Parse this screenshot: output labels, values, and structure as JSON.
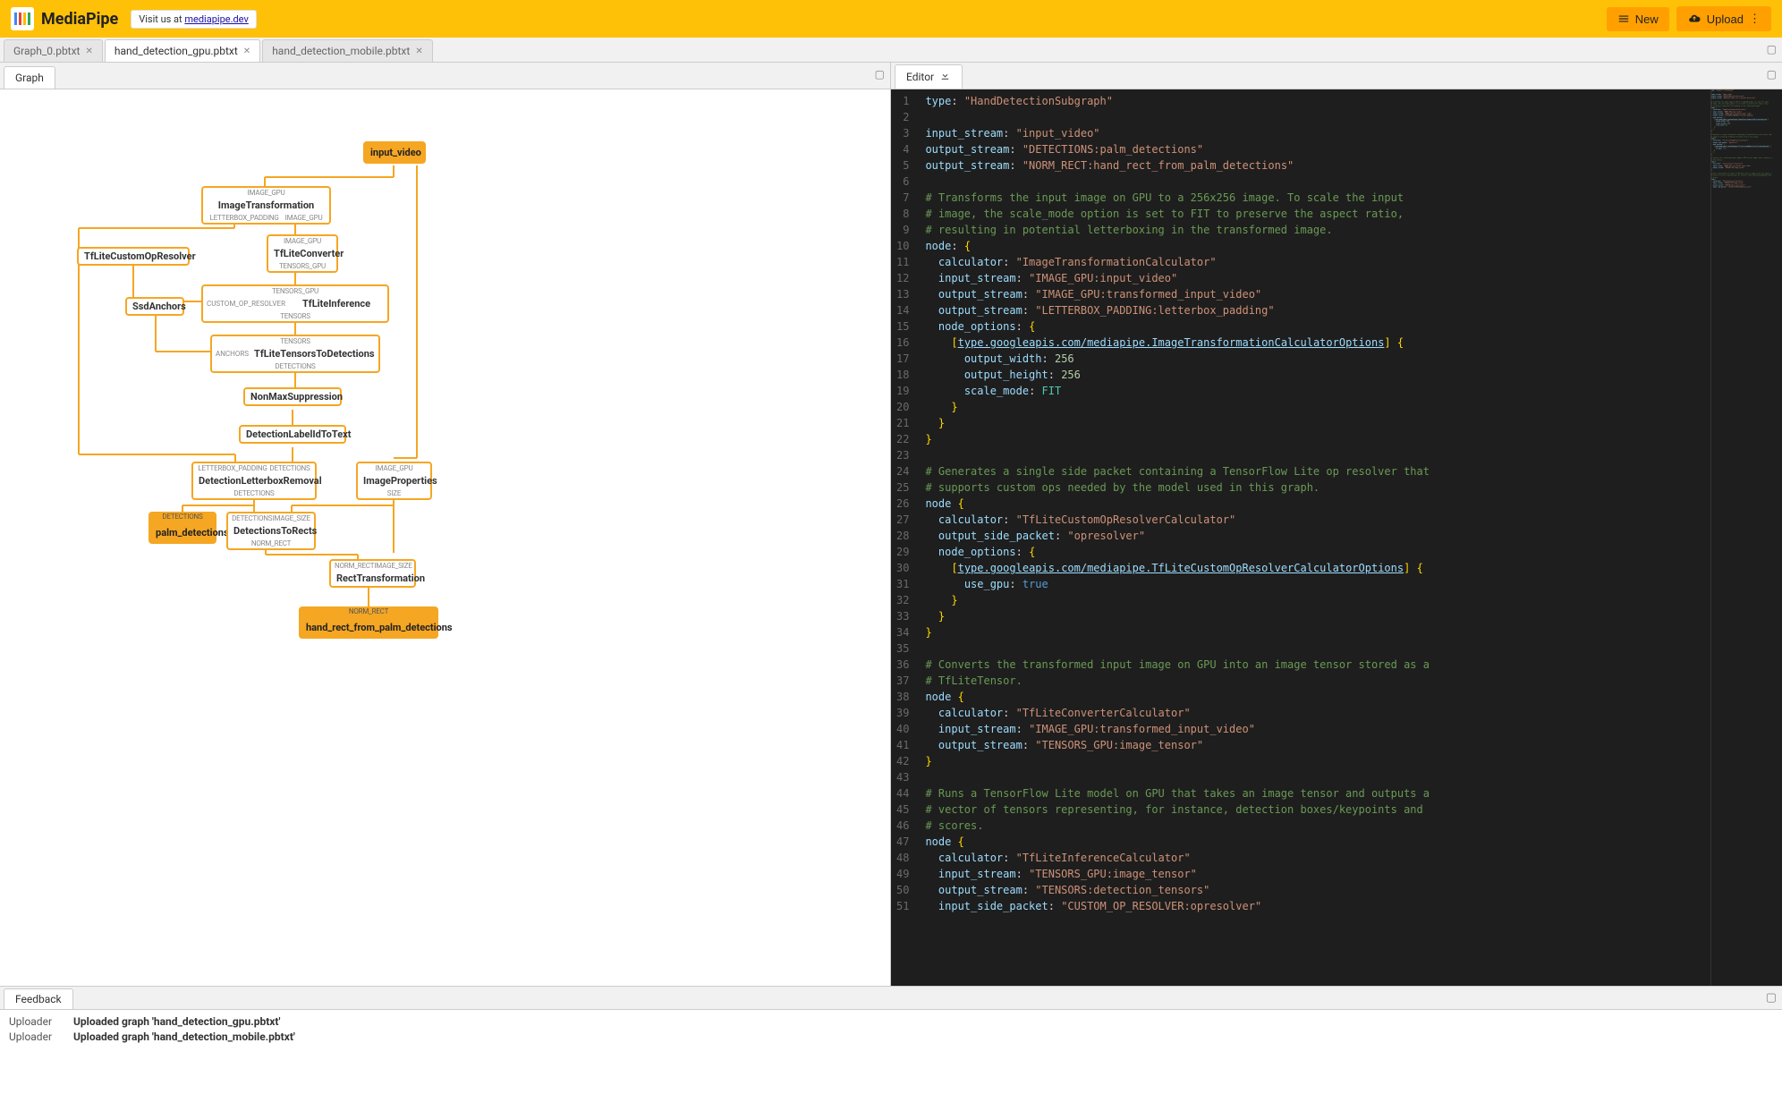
{
  "header": {
    "title": "MediaPipe",
    "visit_prefix": "Visit us at ",
    "visit_link": "mediapipe.dev",
    "new_label": "New",
    "upload_label": "Upload"
  },
  "file_tabs": [
    {
      "label": "Graph_0.pbtxt",
      "active": false
    },
    {
      "label": "hand_detection_gpu.pbtxt",
      "active": true
    },
    {
      "label": "hand_detection_mobile.pbtxt",
      "active": false
    }
  ],
  "left_pane": {
    "tab": "Graph"
  },
  "right_pane": {
    "tab": "Editor"
  },
  "graph": {
    "input_video": "input_video",
    "image_transformation": {
      "top": "IMAGE_GPU",
      "title": "ImageTransformation",
      "bl": "LETTERBOX_PADDING",
      "br": "IMAGE_GPU"
    },
    "tflite_converter": {
      "top": "IMAGE_GPU",
      "title": "TfLiteConverter",
      "bottom": "TENSORS_GPU"
    },
    "tflite_custom": {
      "title": "TfLiteCustomOpResolver"
    },
    "ssd_anchors": {
      "title": "SsdAnchors"
    },
    "tflite_inference": {
      "top": "TENSORS_GPU",
      "left": "CUSTOM_OP_RESOLVER",
      "title": "TfLiteInference",
      "bottom": "TENSORS"
    },
    "tensors_to_det": {
      "top": "TENSORS",
      "left": "ANCHORS",
      "title": "TfLiteTensorsToDetections",
      "bottom": "DETECTIONS"
    },
    "nms": {
      "title": "NonMaxSuppression"
    },
    "label_to_text": {
      "title": "DetectionLabelIdToText"
    },
    "letterbox_removal": {
      "tl": "LETTERBOX_PADDING",
      "tr": "DETECTIONS",
      "title": "DetectionLetterboxRemoval",
      "bottom": "DETECTIONS"
    },
    "image_props": {
      "top": "IMAGE_GPU",
      "title": "ImageProperties",
      "bottom": "SIZE"
    },
    "palm_detections": {
      "top": "DETECTIONS",
      "title": "palm_detections"
    },
    "det_to_rects": {
      "tl": "DETECTIONS",
      "tr": "IMAGE_SIZE",
      "title": "DetectionsToRects",
      "bottom": "NORM_RECT"
    },
    "rect_transform": {
      "tl": "NORM_RECT",
      "tr": "IMAGE_SIZE",
      "title": "RectTransformation"
    },
    "hand_rect": {
      "top": "NORM_RECT",
      "title": "hand_rect_from_palm_detections"
    }
  },
  "code_lines": [
    [
      [
        "key",
        "type"
      ],
      [
        "pun",
        ": "
      ],
      [
        "str",
        "\"HandDetectionSubgraph\""
      ]
    ],
    [],
    [
      [
        "key",
        "input_stream"
      ],
      [
        "pun",
        ": "
      ],
      [
        "str",
        "\"input_video\""
      ]
    ],
    [
      [
        "key",
        "output_stream"
      ],
      [
        "pun",
        ": "
      ],
      [
        "str",
        "\"DETECTIONS:palm_detections\""
      ]
    ],
    [
      [
        "key",
        "output_stream"
      ],
      [
        "pun",
        ": "
      ],
      [
        "str",
        "\"NORM_RECT:hand_rect_from_palm_detections\""
      ]
    ],
    [],
    [
      [
        "com",
        "# Transforms the input image on GPU to a 256x256 image. To scale the input"
      ]
    ],
    [
      [
        "com",
        "# image, the scale_mode option is set to FIT to preserve the aspect ratio,"
      ]
    ],
    [
      [
        "com",
        "# resulting in potential letterboxing in the transformed image."
      ]
    ],
    [
      [
        "key",
        "node"
      ],
      [
        "pun",
        ": "
      ],
      [
        "brace",
        "{"
      ]
    ],
    [
      [
        "pun",
        "  "
      ],
      [
        "key",
        "calculator"
      ],
      [
        "pun",
        ": "
      ],
      [
        "str",
        "\"ImageTransformationCalculator\""
      ]
    ],
    [
      [
        "pun",
        "  "
      ],
      [
        "key",
        "input_stream"
      ],
      [
        "pun",
        ": "
      ],
      [
        "str",
        "\"IMAGE_GPU:input_video\""
      ]
    ],
    [
      [
        "pun",
        "  "
      ],
      [
        "key",
        "output_stream"
      ],
      [
        "pun",
        ": "
      ],
      [
        "str",
        "\"IMAGE_GPU:transformed_input_video\""
      ]
    ],
    [
      [
        "pun",
        "  "
      ],
      [
        "key",
        "output_stream"
      ],
      [
        "pun",
        ": "
      ],
      [
        "str",
        "\"LETTERBOX_PADDING:letterbox_padding\""
      ]
    ],
    [
      [
        "pun",
        "  "
      ],
      [
        "key",
        "node_options"
      ],
      [
        "pun",
        ": "
      ],
      [
        "brace",
        "{"
      ]
    ],
    [
      [
        "pun",
        "    "
      ],
      [
        "brace",
        "["
      ],
      [
        "link",
        "type.googleapis.com/mediapipe.ImageTransformationCalculatorOptions"
      ],
      [
        "brace",
        "]"
      ],
      [
        "pun",
        " "
      ],
      [
        "brace",
        "{"
      ]
    ],
    [
      [
        "pun",
        "      "
      ],
      [
        "key",
        "output_width"
      ],
      [
        "pun",
        ": "
      ],
      [
        "num",
        "256"
      ]
    ],
    [
      [
        "pun",
        "      "
      ],
      [
        "key",
        "output_height"
      ],
      [
        "pun",
        ": "
      ],
      [
        "num",
        "256"
      ]
    ],
    [
      [
        "pun",
        "      "
      ],
      [
        "key",
        "scale_mode"
      ],
      [
        "pun",
        ": "
      ],
      [
        "type",
        "FIT"
      ]
    ],
    [
      [
        "pun",
        "    "
      ],
      [
        "brace",
        "}"
      ]
    ],
    [
      [
        "pun",
        "  "
      ],
      [
        "brace",
        "}"
      ]
    ],
    [
      [
        "brace",
        "}"
      ]
    ],
    [],
    [
      [
        "com",
        "# Generates a single side packet containing a TensorFlow Lite op resolver that"
      ]
    ],
    [
      [
        "com",
        "# supports custom ops needed by the model used in this graph."
      ]
    ],
    [
      [
        "key",
        "node"
      ],
      [
        "pun",
        " "
      ],
      [
        "brace",
        "{"
      ]
    ],
    [
      [
        "pun",
        "  "
      ],
      [
        "key",
        "calculator"
      ],
      [
        "pun",
        ": "
      ],
      [
        "str",
        "\"TfLiteCustomOpResolverCalculator\""
      ]
    ],
    [
      [
        "pun",
        "  "
      ],
      [
        "key",
        "output_side_packet"
      ],
      [
        "pun",
        ": "
      ],
      [
        "str",
        "\"opresolver\""
      ]
    ],
    [
      [
        "pun",
        "  "
      ],
      [
        "key",
        "node_options"
      ],
      [
        "pun",
        ": "
      ],
      [
        "brace",
        "{"
      ]
    ],
    [
      [
        "pun",
        "    "
      ],
      [
        "brace",
        "["
      ],
      [
        "link",
        "type.googleapis.com/mediapipe.TfLiteCustomOpResolverCalculatorOptions"
      ],
      [
        "brace",
        "]"
      ],
      [
        "pun",
        " "
      ],
      [
        "brace",
        "{"
      ]
    ],
    [
      [
        "pun",
        "      "
      ],
      [
        "key",
        "use_gpu"
      ],
      [
        "pun",
        ": "
      ],
      [
        "bool",
        "true"
      ]
    ],
    [
      [
        "pun",
        "    "
      ],
      [
        "brace",
        "}"
      ]
    ],
    [
      [
        "pun",
        "  "
      ],
      [
        "brace",
        "}"
      ]
    ],
    [
      [
        "brace",
        "}"
      ]
    ],
    [],
    [
      [
        "com",
        "# Converts the transformed input image on GPU into an image tensor stored as a"
      ]
    ],
    [
      [
        "com",
        "# TfLiteTensor."
      ]
    ],
    [
      [
        "key",
        "node"
      ],
      [
        "pun",
        " "
      ],
      [
        "brace",
        "{"
      ]
    ],
    [
      [
        "pun",
        "  "
      ],
      [
        "key",
        "calculator"
      ],
      [
        "pun",
        ": "
      ],
      [
        "str",
        "\"TfLiteConverterCalculator\""
      ]
    ],
    [
      [
        "pun",
        "  "
      ],
      [
        "key",
        "input_stream"
      ],
      [
        "pun",
        ": "
      ],
      [
        "str",
        "\"IMAGE_GPU:transformed_input_video\""
      ]
    ],
    [
      [
        "pun",
        "  "
      ],
      [
        "key",
        "output_stream"
      ],
      [
        "pun",
        ": "
      ],
      [
        "str",
        "\"TENSORS_GPU:image_tensor\""
      ]
    ],
    [
      [
        "brace",
        "}"
      ]
    ],
    [],
    [
      [
        "com",
        "# Runs a TensorFlow Lite model on GPU that takes an image tensor and outputs a"
      ]
    ],
    [
      [
        "com",
        "# vector of tensors representing, for instance, detection boxes/keypoints and"
      ]
    ],
    [
      [
        "com",
        "# scores."
      ]
    ],
    [
      [
        "key",
        "node"
      ],
      [
        "pun",
        " "
      ],
      [
        "brace",
        "{"
      ]
    ],
    [
      [
        "pun",
        "  "
      ],
      [
        "key",
        "calculator"
      ],
      [
        "pun",
        ": "
      ],
      [
        "str",
        "\"TfLiteInferenceCalculator\""
      ]
    ],
    [
      [
        "pun",
        "  "
      ],
      [
        "key",
        "input_stream"
      ],
      [
        "pun",
        ": "
      ],
      [
        "str",
        "\"TENSORS_GPU:image_tensor\""
      ]
    ],
    [
      [
        "pun",
        "  "
      ],
      [
        "key",
        "output_stream"
      ],
      [
        "pun",
        ": "
      ],
      [
        "str",
        "\"TENSORS:detection_tensors\""
      ]
    ],
    [
      [
        "pun",
        "  "
      ],
      [
        "key",
        "input_side_packet"
      ],
      [
        "pun",
        ": "
      ],
      [
        "str",
        "\"CUSTOM_OP_RESOLVER:opresolver\""
      ]
    ]
  ],
  "feedback": {
    "tab": "Feedback",
    "rows": [
      {
        "src": "Uploader",
        "msg": "Uploaded graph 'hand_detection_gpu.pbtxt'"
      },
      {
        "src": "Uploader",
        "msg": "Uploaded graph 'hand_detection_mobile.pbtxt'"
      }
    ]
  }
}
